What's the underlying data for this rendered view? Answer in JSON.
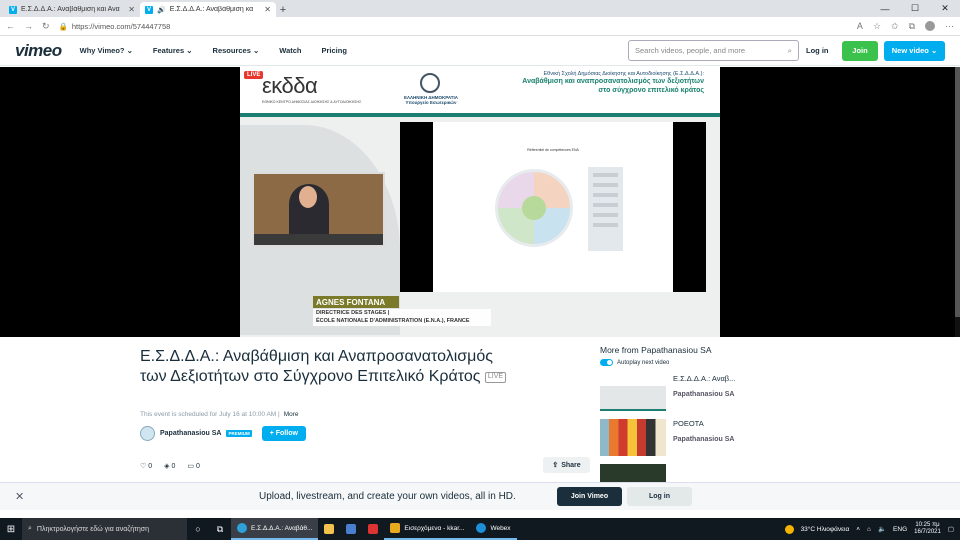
{
  "browser": {
    "tabs": [
      {
        "title": "Ε.Σ.Δ.Δ.Α.: Αναβάθμιση και Ανα"
      },
      {
        "title": "Ε.Σ.Δ.Δ.Α.: Αναβάθμιση κα"
      }
    ],
    "url": "https://vimeo.com/574447758"
  },
  "nav": {
    "logo": "vimeo",
    "menu": [
      "Why Vimeo?",
      "Features",
      "Resources",
      "Watch",
      "Pricing"
    ],
    "search_placeholder": "Search videos, people, and more",
    "login": "Log in",
    "join": "Join",
    "new_video": "New video"
  },
  "video": {
    "live_badge": "LIVE",
    "org_logo": "εκδδα",
    "org_sub": "ΕΘΝΙΚΟ ΚΕΝΤΡΟ ΔΗΜΟΣΙΑΣ ΔΙΟΙΚΗΣΗΣ & ΑΥΤΟΔΙΟΙΚΗΣΗΣ",
    "ministry": "ΕΛΛΗΝΙΚΗ ΔΗΜΟΚΡΑΤΙΑ Υπουργείο Εσωτερικών",
    "banner_line1": "Εθνική Σχολή Δημόσιας Διοίκησης και Αυτοδιοίκησης (Ε.Σ.Δ.Δ.Α.):",
    "banner_line2": "Αναβάθμιση και αναπροσανατολισμός των δεξιοτήτων στο σύγχρονο επιτελικό κράτος",
    "slide_title": "Référentiel de compétences ENA",
    "speaker_name": "AGNES FONTANA",
    "speaker_role1": "DIRECTRICE DES STAGES |",
    "speaker_role2": "ÉCOLE NATIONALE D'ADMINISTRATION (E.N.A.), FRANCE"
  },
  "details": {
    "title": "Ε.Σ.Δ.Δ.Α.: Αναβάθμιση και Αναπροσανατολισμός των Δεξιοτήτων στο Σύγχρονο Επιτελικό Κράτος",
    "live_tag": "LIVE",
    "schedule": "This event is scheduled for July 16 at 10:00 AM",
    "more": "More",
    "channel": "Papathanasiou SA",
    "premium": "PREMIUM",
    "follow": "+ Follow",
    "likes": "0",
    "collections": "0",
    "comments": "0",
    "share": "Share"
  },
  "sidebar": {
    "heading": "More from Papathanasiou SA",
    "autoplay": "Autoplay next video",
    "items": [
      {
        "title": "Ε.Σ.Δ.Δ.Α.: Αναβ...",
        "channel": "Papathanasiou SA"
      },
      {
        "title": "POEOTA",
        "channel": "Papathanasiou SA"
      }
    ]
  },
  "signup_banner": {
    "text": "Upload, livestream, and create your own videos, all in HD.",
    "join": "Join Vimeo",
    "login": "Log in"
  },
  "taskbar": {
    "search": "Πληκτρολογήστε εδώ για αναζήτηση",
    "apps": [
      "Ε.Σ.Δ.Δ.Α.: Αναβάθ...",
      "Εισερχόμενα - kkar...",
      "Webex"
    ],
    "weather": "33°C Ηλιοφάνεια",
    "lang": "ENG",
    "time": "10:25 πμ",
    "date": "16/7/2021"
  },
  "colors": {
    "accent": "#00adef",
    "join": "#3bc24c",
    "text": "#1a2e3b",
    "teal": "#1b7f74"
  }
}
